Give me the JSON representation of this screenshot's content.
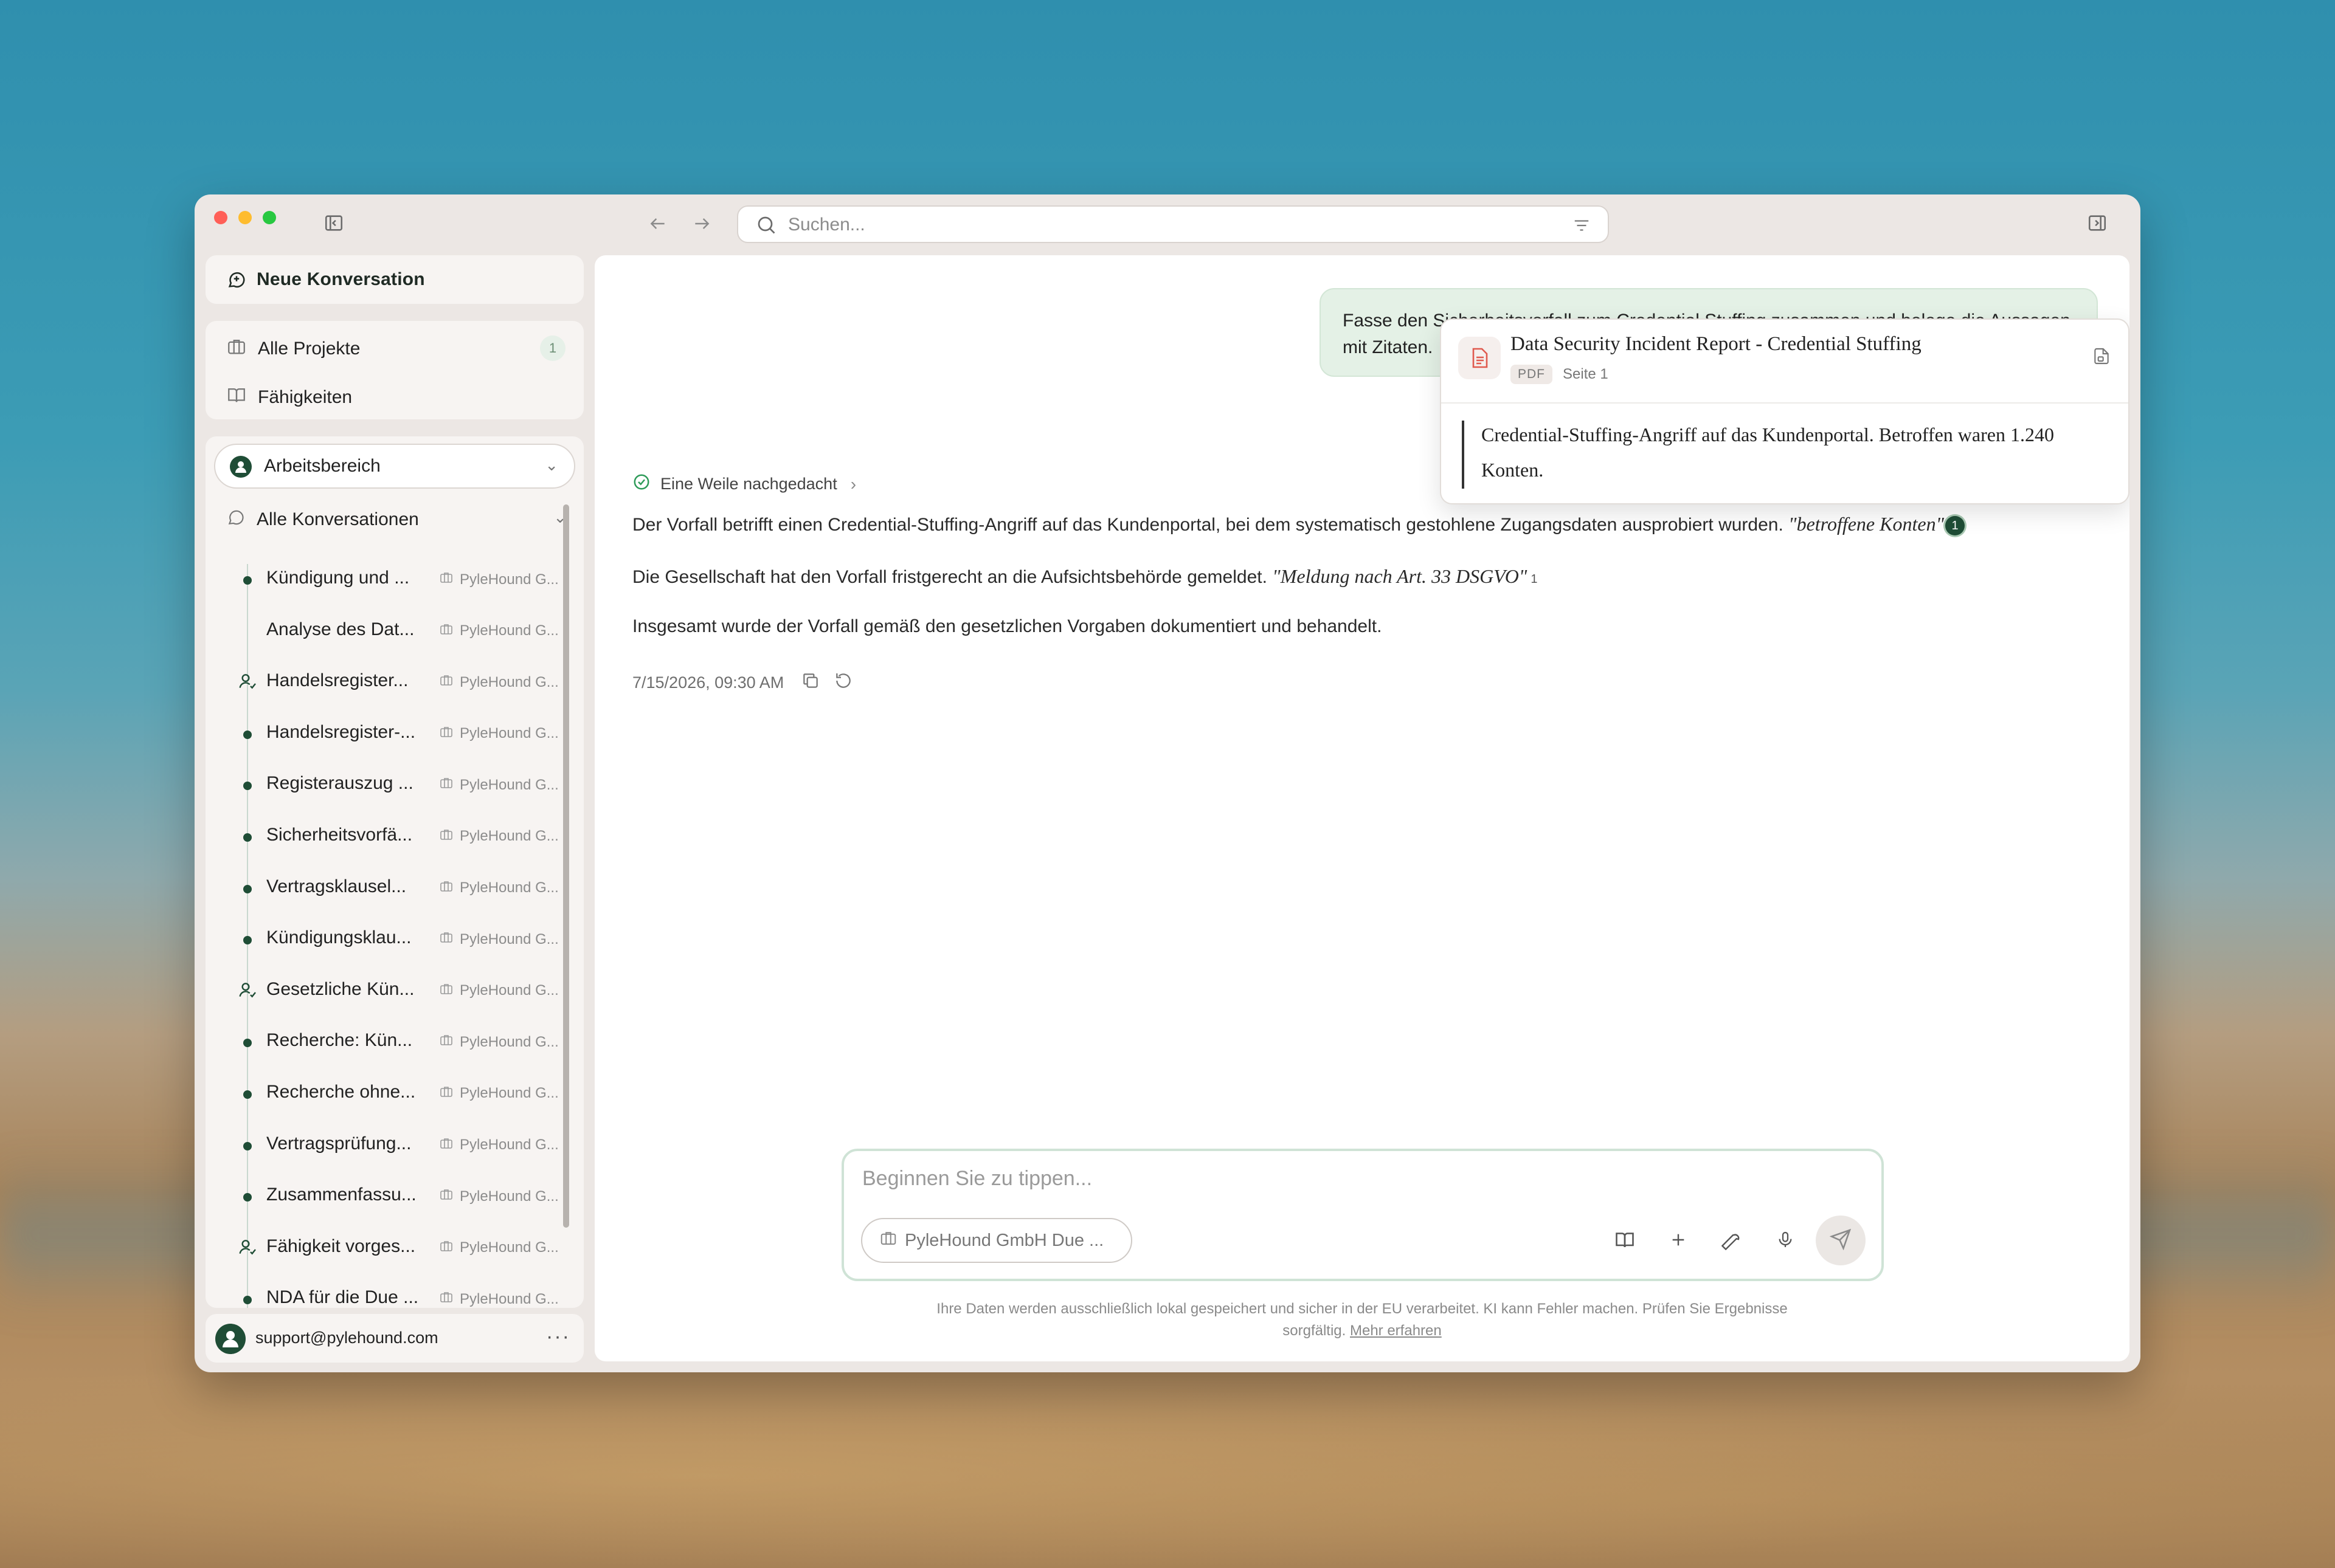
{
  "search": {
    "placeholder": "Suchen..."
  },
  "sidebar": {
    "new_conversation": "Neue Konversation",
    "nav": [
      {
        "label": "Alle Projekte",
        "badge": "1"
      },
      {
        "label": "Fähigkeiten"
      }
    ],
    "workspace": "Arbeitsbereich",
    "all_conversations": "Alle Konversationen",
    "conversations": [
      {
        "title": "Kündigung und ...",
        "project": "PyleHound G...",
        "marker": "dot"
      },
      {
        "title": "Analyse des Dat...",
        "project": "PyleHound G...",
        "marker": "none"
      },
      {
        "title": "Handelsregister...",
        "project": "PyleHound G...",
        "marker": "user"
      },
      {
        "title": "Handelsregister-...",
        "project": "PyleHound G...",
        "marker": "dot"
      },
      {
        "title": "Registerauszug ...",
        "project": "PyleHound G...",
        "marker": "dot"
      },
      {
        "title": "Sicherheitsvorfä...",
        "project": "PyleHound G...",
        "marker": "dot"
      },
      {
        "title": "Vertragsklausel...",
        "project": "PyleHound G...",
        "marker": "dot"
      },
      {
        "title": "Kündigungsklau...",
        "project": "PyleHound G...",
        "marker": "dot"
      },
      {
        "title": "Gesetzliche Kün...",
        "project": "PyleHound G...",
        "marker": "user"
      },
      {
        "title": "Recherche: Kün...",
        "project": "PyleHound G...",
        "marker": "dot"
      },
      {
        "title": "Recherche ohne...",
        "project": "PyleHound G...",
        "marker": "dot"
      },
      {
        "title": "Vertragsprüfung...",
        "project": "PyleHound G...",
        "marker": "dot"
      },
      {
        "title": "Zusammenfassu...",
        "project": "PyleHound G...",
        "marker": "dot"
      },
      {
        "title": "Fähigkeit vorges...",
        "project": "PyleHound G...",
        "marker": "user"
      },
      {
        "title": "NDA für die Due ...",
        "project": "PyleHound G...",
        "marker": "dot"
      }
    ],
    "user_email": "support@pylehound.com"
  },
  "chat": {
    "user_message": "Fasse den Sicherheitsvorfall zum Credential Stuffing zusammen und belege die Aussagen mit Zitaten.",
    "thought_label": "Eine Weile nachgedacht",
    "paragraphs": [
      {
        "text": "Der Vorfall betrifft einen Credential-Stuffing-Angriff auf das Kundenportal, bei dem systematisch gestohlene Zugangsdaten ausprobiert wurden. ",
        "quote": "\"betroffene Konten\"",
        "cite": "1"
      },
      {
        "text": "Die Gesellschaft hat den Vorfall fristgerecht an die Aufsichtsbehörde gemeldet. ",
        "quote": "\"Meldung nach Art. 33 DSGVO\"",
        "cite": "1"
      },
      {
        "text": "Insgesamt wurde der Vorfall gemäß den gesetzlichen Vorgaben dokumentiert und behandelt.",
        "quote": "",
        "cite": ""
      }
    ],
    "timestamp": "7/15/2026, 09:30 AM"
  },
  "citation_popover": {
    "title": "Data Security Incident Report - Credential Stuffing",
    "type": "PDF",
    "page": "Seite 1",
    "quote": "Credential-Stuffing-Angriff auf das Kundenportal. Betroffen waren 1.240 Konten."
  },
  "composer": {
    "placeholder": "Beginnen Sie zu tippen...",
    "project_chip": "PyleHound GmbH Due ..."
  },
  "footer": {
    "disclaimer_line1": "Ihre Daten werden ausschließlich lokal gespeichert und sicher in der EU verarbeitet. KI kann Fehler machen. Prüfen Sie Ergebnisse",
    "disclaimer_line2": "sorgfältig.",
    "learn_more": "Mehr erfahren"
  },
  "colors": {
    "accent": "#1f4d36",
    "user_bubble": "#e4f1e6",
    "window_bg": "#ece7e4",
    "traffic_red": "#ff5f57",
    "traffic_yellow": "#febc2e",
    "traffic_green": "#28c840"
  }
}
